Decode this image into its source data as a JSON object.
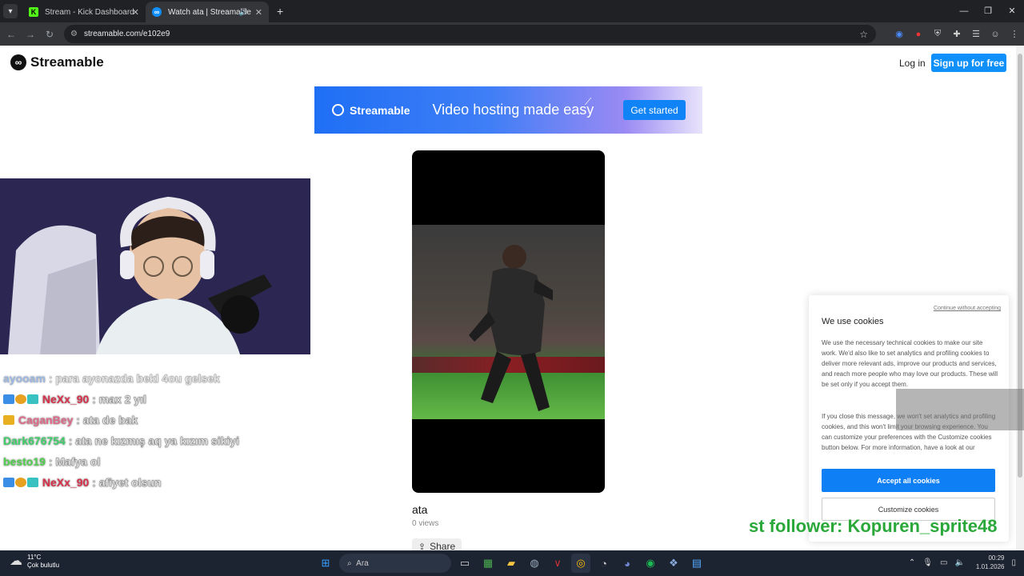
{
  "browser": {
    "tabs": [
      {
        "title": "Stream - Kick Dashboard",
        "favicon": "K",
        "active": false
      },
      {
        "title": "Watch ata | Streamable",
        "favicon": "∞",
        "active": true
      }
    ],
    "new_tab": "+",
    "url": "streamable.com/e102e9"
  },
  "site": {
    "logo_text": "Streamable",
    "login": "Log in",
    "signup": "Sign up for free"
  },
  "banner": {
    "logo_text": "Streamable",
    "tagline": "Video hosting made easy",
    "cta": "Get started"
  },
  "video": {
    "title": "ata",
    "views": "0 views",
    "share": "Share"
  },
  "chat": [
    {
      "user": "ayooam",
      "user_color": "#7ba0d6",
      "message": ": para ayonazda bekl 4ou gelsek"
    },
    {
      "user": "NeXx_90",
      "user_color": "#d9304c",
      "message": ": max 2 yıl"
    },
    {
      "user": "CaganBey",
      "user_color": "#e06a8a",
      "message": ": ata de bak"
    },
    {
      "user": "Dark676754",
      "user_color": "#3fcf6a",
      "message": ": ata ne kızmış aq ya kızım sikiyi"
    },
    {
      "user": "besto19",
      "user_color": "#52d04f",
      "message": ": Mafya ol"
    },
    {
      "user": "NeXx_90",
      "user_color": "#d9304c",
      "message": ": afiyet olsun"
    }
  ],
  "cookies": {
    "continue": "Continue without accepting",
    "title": "We use cookies",
    "para1": "We use the necessary technical cookies to make our site work. We'd also like to set analytics and profiling cookies to deliver more relevant ads, improve our products and services, and reach more people who may love our products. These will be set only if you accept them.",
    "para2": "If you close this message, we won't set analytics and profiling cookies, and this won't limit your browsing experience. You can customize your preferences with the Customize cookies button below. For more information, have a look at our",
    "accept": "Accept all cookies",
    "customize": "Customize cookies"
  },
  "stream_overlay": {
    "follower_text": "st follower: Kopuren_sprite48"
  },
  "taskbar": {
    "temperature": "11°C",
    "weather": "Çok bulutlu",
    "search": "Ara",
    "time": "00:29",
    "date": "1.01.2026"
  },
  "colors": {
    "accent": "#0f90fa",
    "chrome_dark": "#202124",
    "taskbar": "#1c2331"
  }
}
